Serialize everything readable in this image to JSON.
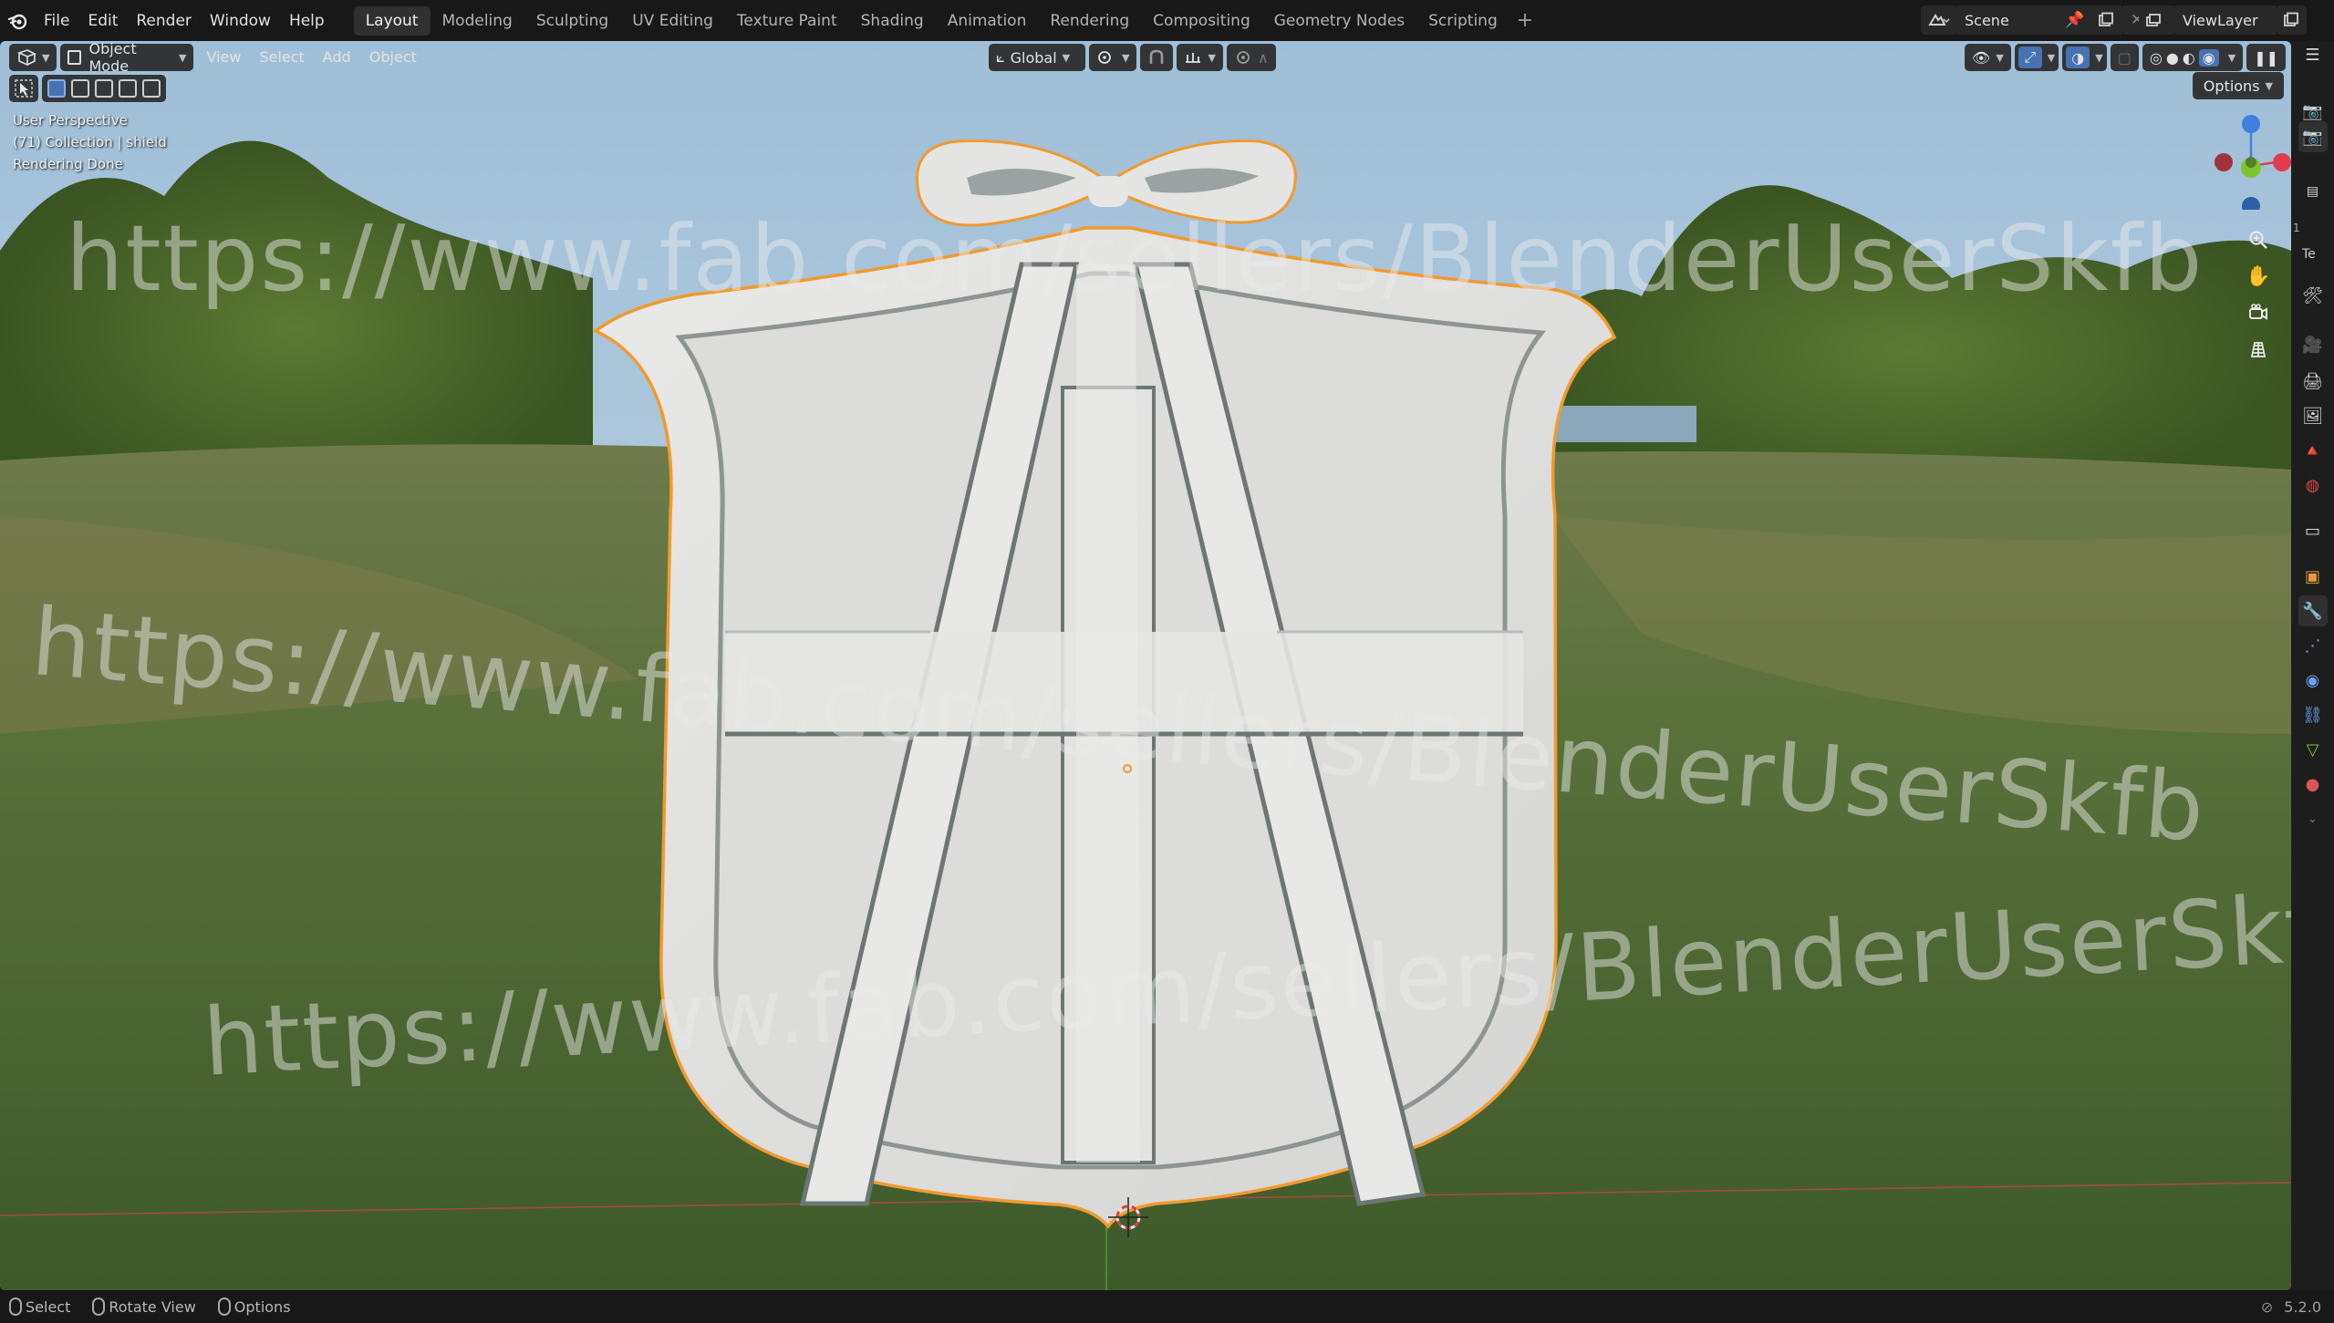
{
  "topbar": {
    "menus": [
      "File",
      "Edit",
      "Render",
      "Window",
      "Help"
    ],
    "workspaces": [
      "Layout",
      "Modeling",
      "Sculpting",
      "UV Editing",
      "Texture Paint",
      "Shading",
      "Animation",
      "Rendering",
      "Compositing",
      "Geometry Nodes",
      "Scripting"
    ],
    "active_workspace": "Layout",
    "add_workspace": "+",
    "scene_name": "Scene",
    "view_layer": "ViewLayer"
  },
  "viewport_header": {
    "mode": "Object Mode",
    "menus": [
      "View",
      "Select",
      "Add",
      "Object"
    ],
    "transform_orientation": "Global",
    "options_label": "Options"
  },
  "viewport_overlay": {
    "perspective": "User Perspective",
    "collection_line": "(71) Collection | shield",
    "status": "Rendering Done"
  },
  "gizmo": {
    "z_label": "Z",
    "x_label": "X",
    "y_label": "Y"
  },
  "watermark_text": "https://www.fab.com/sellers/BlenderUserSkfb",
  "right_panel_labels": {
    "item1": "1",
    "item2": "Te"
  },
  "statusbar": {
    "select_label": "Select",
    "rotate_label": "Rotate View",
    "options_label": "Options",
    "version": "5.2.0"
  },
  "colors": {
    "accent_blue": "#4772b3",
    "selection_outline": "#f29a2e",
    "axis_x": "#e23b4f",
    "axis_y": "#7ec42e",
    "axis_z": "#3e7fe0"
  }
}
